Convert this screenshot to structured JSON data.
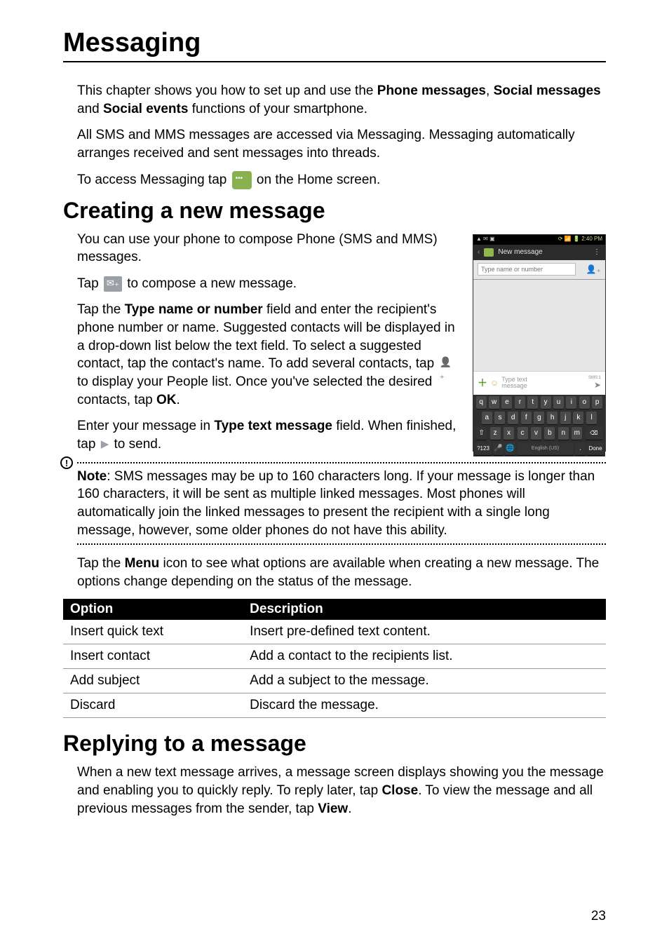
{
  "page_title": "Messaging",
  "intro1_a": "This chapter shows you how to set up and use the ",
  "intro1_b": "Phone messages",
  "intro1_c": ", ",
  "intro1_d": "Social messages",
  "intro1_e": " and ",
  "intro1_f": "Social events",
  "intro1_g": " functions of your smartphone.",
  "intro2": "All SMS and MMS messages are accessed via Messaging. Messaging automatically arranges received and sent messages into threads.",
  "intro3_a": "To access Messaging tap ",
  "intro3_b": " on the Home screen.",
  "heading1": "Creating a new message",
  "create1": "You can use your phone to compose Phone (SMS and MMS) messages.",
  "create2_a": "Tap ",
  "create2_b": " to compose a new message.",
  "create3_a": "Tap the ",
  "create3_b": "Type name or number",
  "create3_c": " field and enter the recipient's phone number or name. Suggested contacts will be displayed in a drop-down list below the text field. To select a suggested contact, tap the contact's name. To add several contacts, tap ",
  "create3_d": " to display your People list. Once you've selected the desired contacts, tap ",
  "create3_e": "OK",
  "create3_f": ".",
  "create4_a": "Enter your message in ",
  "create4_b": "Type text message",
  "create4_c": " field. When finished, tap ",
  "create4_d": " to send.",
  "note_label": "Note",
  "note_text": ": SMS messages may be up to 160 characters long. If your message is longer than 160 characters, it will be sent as multiple linked messages. Most phones will automatically join the linked messages to present the recipient with a single long message, however, some older phones do not have this ability.",
  "menu_para_a": "Tap the ",
  "menu_para_b": "Menu",
  "menu_para_c": " icon to see what options are available when creating a new message. The options change depending on the status of the message.",
  "table": {
    "head_option": "Option",
    "head_desc": "Description",
    "rows": [
      {
        "option": "Insert quick text",
        "desc": "Insert pre-defined text content."
      },
      {
        "option": "Insert contact",
        "desc": "Add a contact to the recipients list."
      },
      {
        "option": "Add subject",
        "desc": "Add a subject to the message."
      },
      {
        "option": "Discard",
        "desc": "Discard the message."
      }
    ]
  },
  "heading2": "Replying to a message",
  "reply1_a": "When a new text message arrives, a message screen displays showing you the message and enabling you to quickly reply. To reply later, tap ",
  "reply1_b": "Close",
  "reply1_c": ". To view the message and all previous messages from the sender, tap ",
  "reply1_d": "View",
  "reply1_e": ".",
  "page_number": "23",
  "screenshot": {
    "status_left": "▲  ✉  ▣",
    "status_right": "⟳ 📶 🔋 2:40 PM",
    "header_title": "New message",
    "header_dots": "⋮",
    "recipient_placeholder": "Type name or number",
    "compose_placeholder_l1": "Type text",
    "compose_placeholder_l2": "message",
    "sms_counter": "SMS:1",
    "kb_row1": [
      "q",
      "w",
      "e",
      "r",
      "t",
      "y",
      "u",
      "i",
      "o",
      "p"
    ],
    "kb_row2": [
      "a",
      "s",
      "d",
      "f",
      "g",
      "h",
      "j",
      "k",
      "l"
    ],
    "kb_row3_shift": "⇧",
    "kb_row3": [
      "z",
      "x",
      "c",
      "v",
      "b",
      "n",
      "m"
    ],
    "kb_row3_del": "⌫",
    "kb_bottom_sym": "?123",
    "kb_bottom_mic": "🎤",
    "kb_bottom_globe": "🌐",
    "kb_bottom_space": "English (US)",
    "kb_bottom_dot": ".",
    "kb_bottom_done": "Done"
  }
}
